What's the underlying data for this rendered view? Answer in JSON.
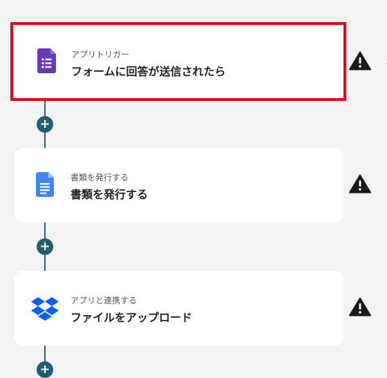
{
  "steps": [
    {
      "subtitle": "アプリトリガー",
      "title": "フォームに回答が送信されたら",
      "icon": "google-forms-icon",
      "selected": true,
      "warning_icon": "warning-icon"
    },
    {
      "subtitle": "書類を発行する",
      "title": "書類を発行する",
      "icon": "google-docs-icon",
      "selected": false,
      "warning_icon": "warning-icon"
    },
    {
      "subtitle": "アプリと連携する",
      "title": "ファイルをアップロード",
      "icon": "dropbox-icon",
      "selected": false,
      "warning_icon": "warning-icon"
    }
  ],
  "add_step_symbol": "+",
  "colors": {
    "selection_border": "#e60012",
    "connector": "#1f5f70",
    "forms_purple": "#673ab7",
    "docs_blue": "#4285f4",
    "dropbox_blue": "#0061fe",
    "warning": "#1a1a1a",
    "background": "#f3f3f3"
  }
}
